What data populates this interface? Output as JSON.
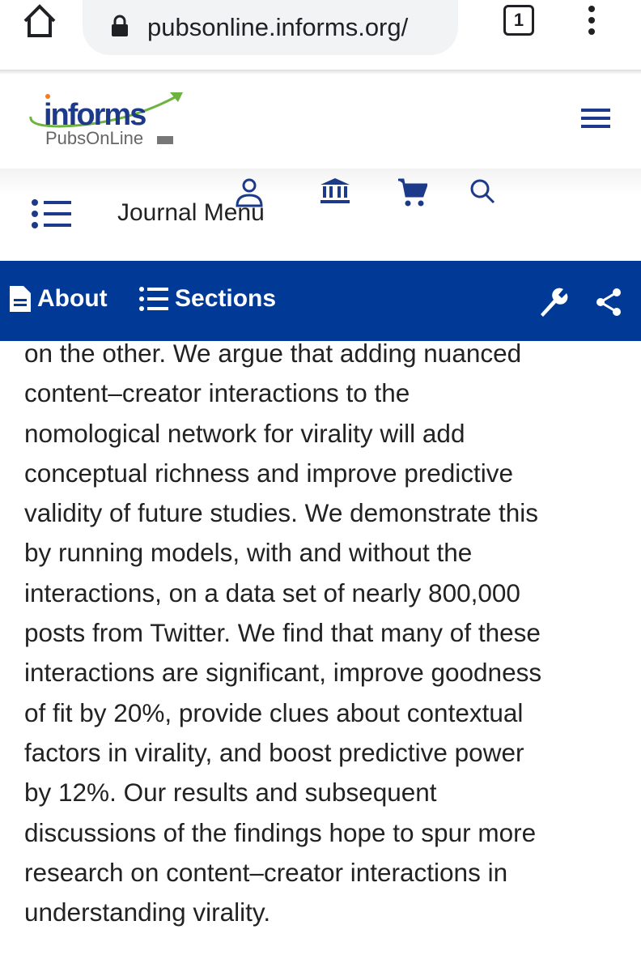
{
  "browser": {
    "url": "pubsonline.informs.org/",
    "tab_count": "1"
  },
  "logo": {
    "text": "informs",
    "sub": "PubsOnLine"
  },
  "journal_menu": {
    "label": "Journal Menu"
  },
  "toolbar": {
    "about": "About",
    "sections": "Sections"
  },
  "colors": {
    "brand_blue": "#003a96",
    "logo_green": "#6cb33f"
  },
  "abstract_lines": [
    "on the other. We argue that adding nuanced",
    "content–creator interactions to the",
    "nomological network for virality will add",
    "conceptual richness and improve predictive",
    "validity of future studies. We demonstrate this",
    "by running models, with and without the",
    "interactions, on a data set of nearly 800,000",
    "posts from Twitter. We find that many of these",
    "interactions are significant, improve goodness",
    "of fit by 20%, provide clues about contextual",
    "factors in virality, and boost predictive power",
    "by 12%. Our results and subsequent",
    "discussions of the findings hope to spur more",
    "research on content–creator interactions in",
    "understanding virality."
  ]
}
